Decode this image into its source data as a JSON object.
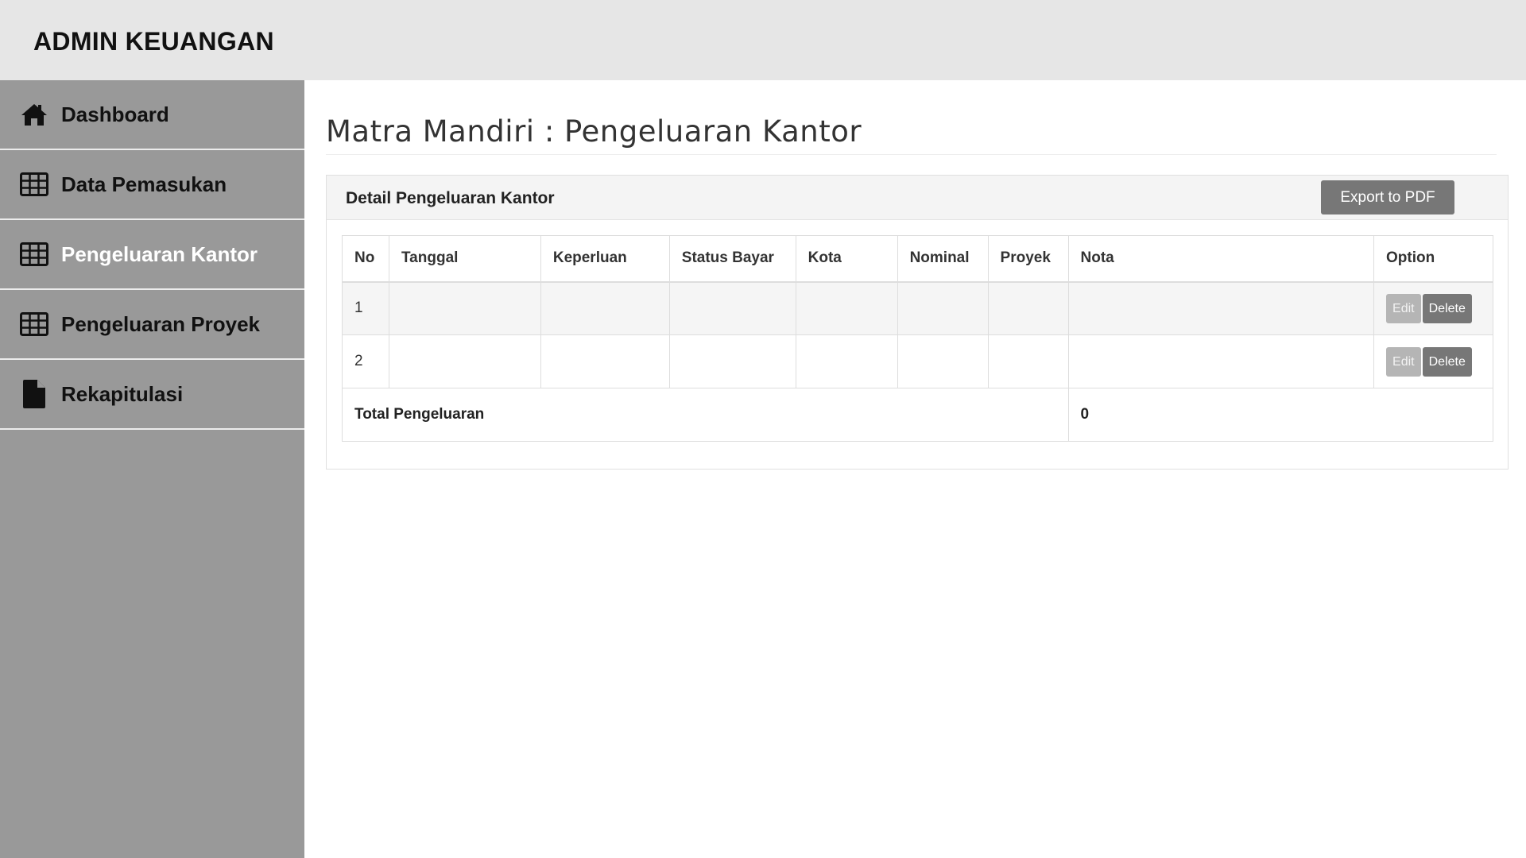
{
  "header": {
    "brand": "ADMIN KEUANGAN"
  },
  "sidebar": {
    "items": [
      {
        "label": "Dashboard",
        "icon": "home-icon"
      },
      {
        "label": "Data Pemasukan",
        "icon": "table-icon"
      },
      {
        "label": "Pengeluaran Kantor",
        "icon": "table-icon",
        "active": true
      },
      {
        "label": "Pengeluaran Proyek",
        "icon": "table-icon"
      },
      {
        "label": "Rekapitulasi",
        "icon": "file-icon"
      }
    ]
  },
  "main": {
    "title": "Matra Mandiri : Pengeluaran Kantor",
    "panel": {
      "title": "Detail Pengeluaran Kantor",
      "export_label": "Export to PDF"
    },
    "table": {
      "columns": [
        "No",
        "Tanggal",
        "Keperluan",
        "Status Bayar",
        "Kota",
        "Nominal",
        "Proyek",
        "Nota",
        "Option"
      ],
      "rows": [
        {
          "no": "1",
          "tanggal": "",
          "keperluan": "",
          "status_bayar": "",
          "kota": "",
          "nominal": "",
          "proyek": "",
          "nota": "",
          "edit_label": "Edit",
          "delete_label": "Delete"
        },
        {
          "no": "2",
          "tanggal": "",
          "keperluan": "",
          "status_bayar": "",
          "kota": "",
          "nominal": "",
          "proyek": "",
          "nota": "",
          "edit_label": "Edit",
          "delete_label": "Delete"
        }
      ],
      "total_label": "Total Pengeluaran",
      "total_value": "0"
    }
  },
  "colors": {
    "header_bg": "#e6e6e6",
    "sidebar_bg": "#999999",
    "active_text": "#ffffff",
    "button_dark": "#777777",
    "button_light": "#b5b5b5"
  }
}
